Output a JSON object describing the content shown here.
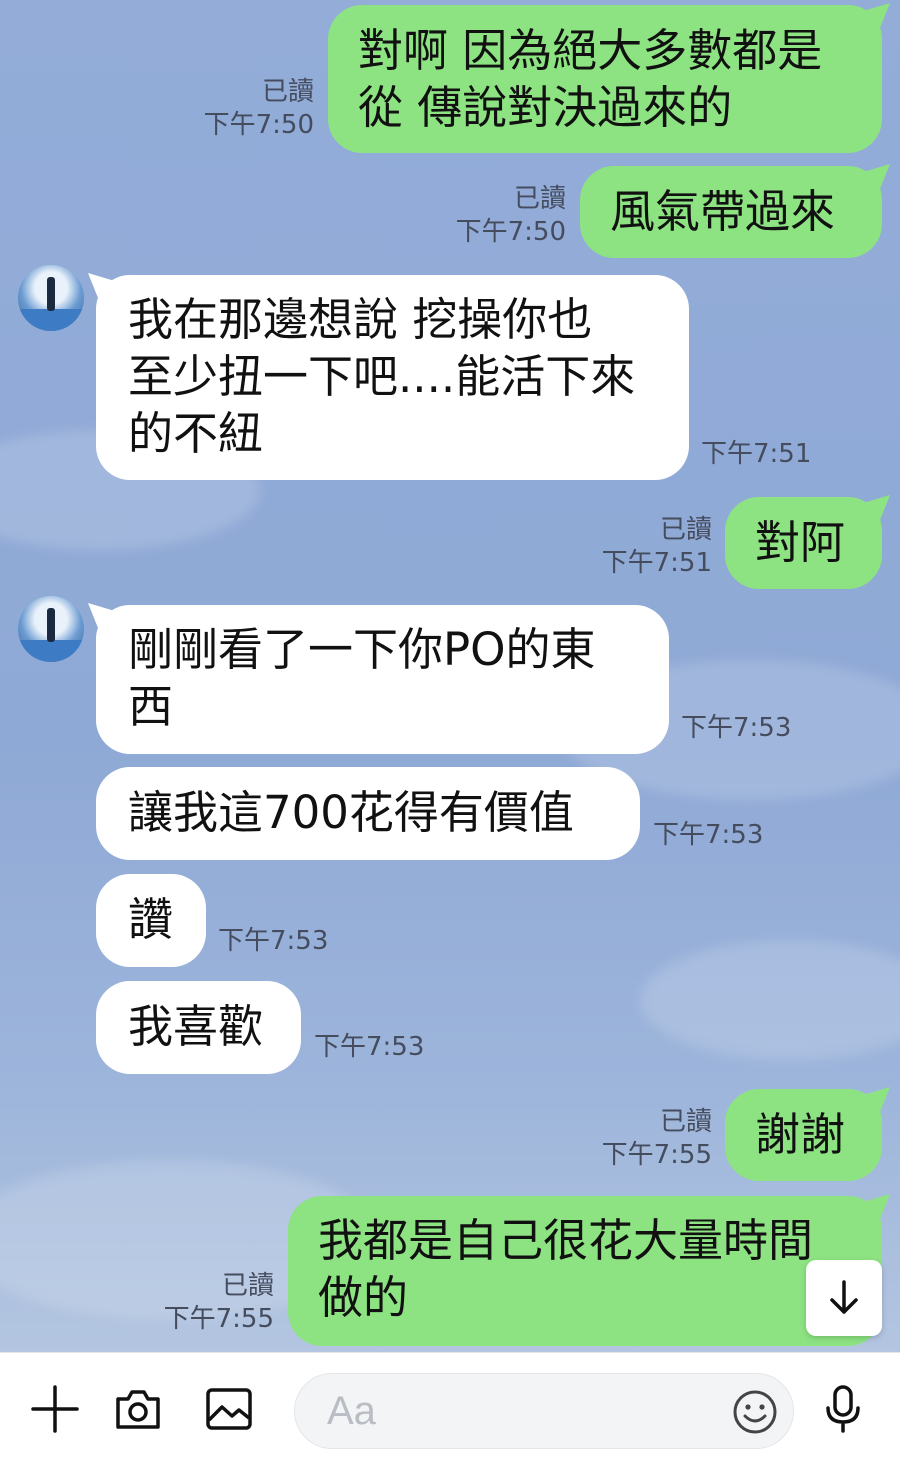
{
  "messages": [
    {
      "side": "me",
      "lines": [
        "對啊 因為絕大多數都是",
        "從 傳說對決過來的"
      ],
      "read": "已讀",
      "time": "下午7:50"
    },
    {
      "side": "me",
      "lines": [
        "風氣帶過來"
      ],
      "read": "已讀",
      "time": "下午7:50"
    },
    {
      "side": "them",
      "lines": [
        "我在那邊想說  挖操你也",
        "至少扭一下吧....能活下來",
        "的不紐"
      ],
      "time": "下午7:51"
    },
    {
      "side": "me",
      "lines": [
        "對阿"
      ],
      "read": "已讀",
      "time": "下午7:51"
    },
    {
      "side": "them",
      "lines": [
        "剛剛看了一下你PO的東",
        "西"
      ],
      "time": "下午7:53"
    },
    {
      "side": "them",
      "lines": [
        "讓我這700花得有價值"
      ],
      "time": "下午7:53"
    },
    {
      "side": "them",
      "lines": [
        "讚"
      ],
      "time": "下午7:53"
    },
    {
      "side": "them",
      "lines": [
        "我喜歡"
      ],
      "time": "下午7:53"
    },
    {
      "side": "me",
      "lines": [
        "謝謝"
      ],
      "read": "已讀",
      "time": "下午7:55"
    },
    {
      "side": "me",
      "lines": [
        "我都是自己很花大量時間",
        "做的"
      ],
      "read": "已讀",
      "time": "下午7:55"
    }
  ],
  "input": {
    "placeholder": "Aa"
  },
  "icons": [
    "plus-icon",
    "camera-icon",
    "image-icon",
    "emoji-icon",
    "microphone-icon",
    "arrow-down-icon"
  ],
  "colors": {
    "my_bubble": "#8de382",
    "their_bubble": "#ffffff",
    "chat_bg": "#8ea9d7"
  }
}
